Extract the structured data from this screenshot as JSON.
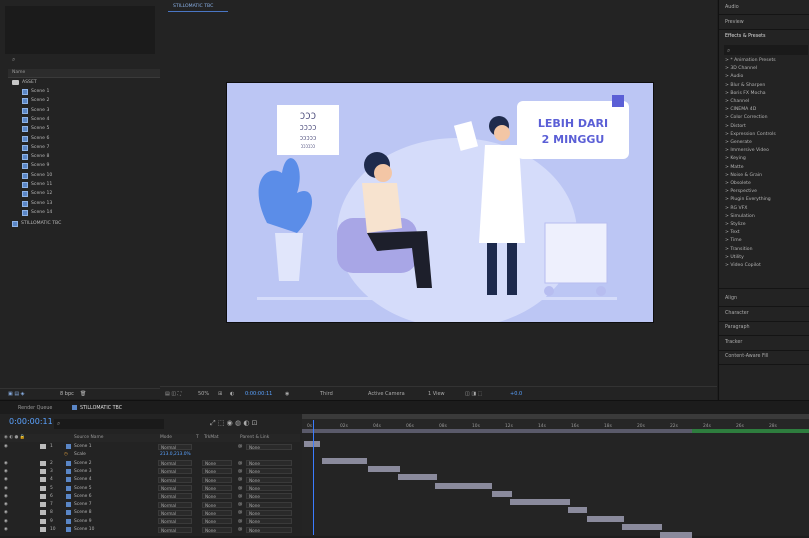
{
  "project": {
    "folder": "ASSET",
    "scenes": [
      "Scene 1",
      "Scene 2",
      "Scene 3",
      "Scene 4",
      "Scene 5",
      "Scene 6",
      "Scene 7",
      "Scene 8",
      "Scene 9",
      "Scene 10",
      "Scene 11",
      "Scene 12",
      "Scene 13",
      "Scene 14"
    ],
    "comp_item": "STILLOMATIC TBC",
    "name_header": "Name",
    "footer_bpc": "8 bpc"
  },
  "composition": {
    "tab_label": "STILLOMATIC TBC",
    "canvas": {
      "badge_line1": "LEBIH DARI",
      "badge_line2": "2 MINGGU",
      "eye_chart_lines": [
        "ƆƆƆ",
        "ƆƆƆƆ",
        "ƆƆƆƆƆ",
        "ƆƆƆƆƆƆ"
      ]
    },
    "viewer_bar": {
      "zoom": "50%",
      "timecode": "0:00:00:11",
      "resolution": "Third",
      "camera": "Active Camera",
      "views": "1 View",
      "exposure": "+0.0"
    }
  },
  "right_panel": {
    "tabs_top": [
      "Audio",
      "Preview",
      "Effects & Presets"
    ],
    "effects": [
      "* Animation Presets",
      "3D Channel",
      "Audio",
      "Blur & Sharpen",
      "Boris FX Mocha",
      "Channel",
      "CINEMA 4D",
      "Color Correction",
      "Distort",
      "Expression Controls",
      "Generate",
      "Immersive Video",
      "Keying",
      "Matte",
      "Noise & Grain",
      "Obsolete",
      "Perspective",
      "Plugin Everything",
      "RG VFX",
      "Simulation",
      "Stylize",
      "Text",
      "Time",
      "Transition",
      "Utility",
      "Video Copilot"
    ],
    "tabs_bottom": [
      "Align",
      "Character",
      "Paragraph",
      "Tracker",
      "Content-Aware Fill"
    ]
  },
  "timeline": {
    "tabs": [
      "Render Queue",
      "STILLOMATIC TBC"
    ],
    "timecode": "0:00:00:11",
    "headers": {
      "source_name": "Source Name",
      "mode": "Mode",
      "t": "T",
      "trkmat": "TrkMat",
      "parent": "Parent & Link"
    },
    "layers": [
      {
        "num": "1",
        "name": "Scene 1",
        "mode": "Normal",
        "trkmat": "",
        "parent": "None"
      },
      {
        "num": "",
        "name": "Scale",
        "mode": "",
        "trkmat": "",
        "parent": "",
        "value": "213.0,213.0%"
      },
      {
        "num": "2",
        "name": "Scene 2",
        "mode": "Normal",
        "trkmat": "None",
        "parent": "None"
      },
      {
        "num": "3",
        "name": "Scene 3",
        "mode": "Normal",
        "trkmat": "None",
        "parent": "None"
      },
      {
        "num": "4",
        "name": "Scene 4",
        "mode": "Normal",
        "trkmat": "None",
        "parent": "None"
      },
      {
        "num": "5",
        "name": "Scene 5",
        "mode": "Normal",
        "trkmat": "None",
        "parent": "None"
      },
      {
        "num": "6",
        "name": "Scene 6",
        "mode": "Normal",
        "trkmat": "None",
        "parent": "None"
      },
      {
        "num": "7",
        "name": "Scene 7",
        "mode": "Normal",
        "trkmat": "None",
        "parent": "None"
      },
      {
        "num": "8",
        "name": "Scene 8",
        "mode": "Normal",
        "trkmat": "None",
        "parent": "None"
      },
      {
        "num": "9",
        "name": "Scene 9",
        "mode": "Normal",
        "trkmat": "None",
        "parent": "None"
      },
      {
        "num": "10",
        "name": "Scene 10",
        "mode": "Normal",
        "trkmat": "None",
        "parent": "None"
      }
    ],
    "ruler_ticks": [
      "0s",
      "02s",
      "04s",
      "06s",
      "08s",
      "10s",
      "12s",
      "14s",
      "16s",
      "18s",
      "20s",
      "22s",
      "24s",
      "26s",
      "28s"
    ]
  },
  "colors": {
    "accent": "#3b7cff",
    "canvas_bg": "#bcc6f4",
    "badge": "#5b5fd6"
  }
}
